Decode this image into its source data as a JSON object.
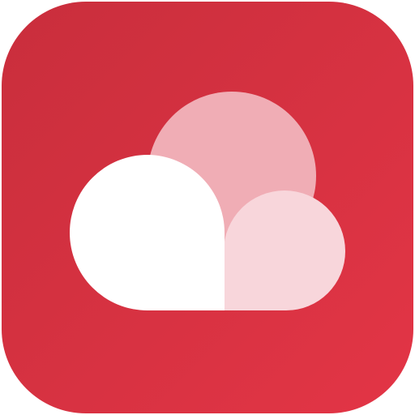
{
  "app_icon": {
    "icon": "cloud-icon",
    "colors": {
      "background_start": "#c92e3c",
      "background_end": "#e33546",
      "cloud_back": "#f0adb5",
      "cloud_right": "#f8d6db",
      "cloud_front": "#ffffff"
    }
  }
}
